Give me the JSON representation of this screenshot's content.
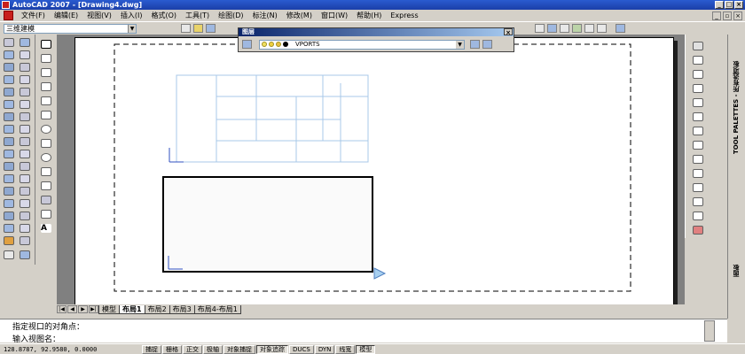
{
  "window": {
    "title": "AutoCAD 2007 - [Drawing4.dwg]"
  },
  "menu": [
    "文件(F)",
    "编辑(E)",
    "视图(V)",
    "插入(I)",
    "格式(O)",
    "工具(T)",
    "绘图(D)",
    "标注(N)",
    "修改(M)",
    "窗口(W)",
    "帮助(H)",
    "Express"
  ],
  "workspace": {
    "value": "三维建模"
  },
  "layer_panel": {
    "title": "图层",
    "current_layer": "VPORTS",
    "close": "×"
  },
  "tabs": [
    "模型",
    "布局1",
    "布局2",
    "布局3",
    "布局4-布局1"
  ],
  "tabs_active": "布局1",
  "command": {
    "line1": "指定视口的对角点：",
    "line2": "输入视图名："
  },
  "status": {
    "coords": "128.8787, 92.9580, 0.0000",
    "buttons": [
      "捕捉",
      "栅格",
      "正交",
      "极轴",
      "对象捕捉",
      "对象追踪",
      "DUCS",
      "DYN",
      "线宽",
      "模型"
    ],
    "on": [
      "对象追踪",
      "模型"
    ]
  },
  "palette": {
    "label1": "TOOL PALETTES - 所有选项板",
    "label2": "面板"
  },
  "colors": {
    "title": "#1b3fa8",
    "background": "#d4d0c8",
    "paper": "#ffffff",
    "viewport_lines": "#a8c8e8"
  }
}
